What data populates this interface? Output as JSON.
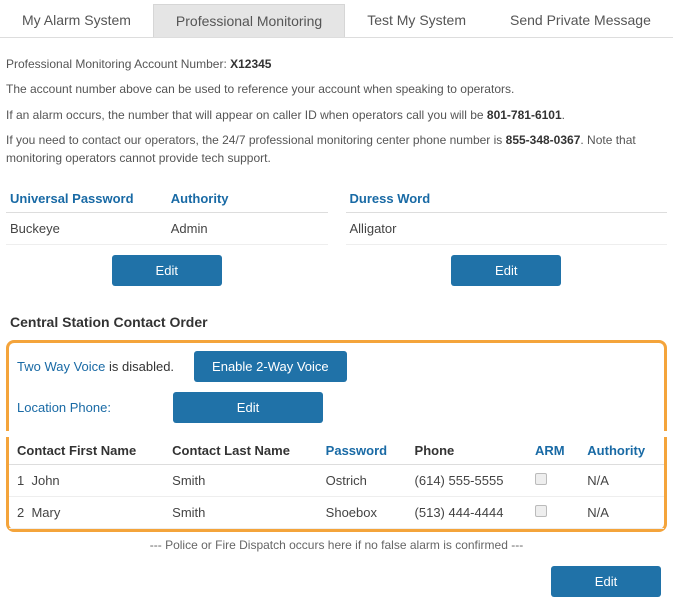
{
  "tabs": [
    {
      "label": "My Alarm System"
    },
    {
      "label": "Professional Monitoring"
    },
    {
      "label": "Test My System"
    },
    {
      "label": "Send Private Message"
    }
  ],
  "activeTab": 1,
  "account": {
    "prefix": "Professional Monitoring Account Number: ",
    "number": "X12345"
  },
  "blurbs": {
    "line1": "The account number above can be used to reference your account when speaking to operators.",
    "line2_pre": "If an alarm occurs, the number that will appear on caller ID when operators call you will be ",
    "line2_num": "801-781-6101",
    "line2_post": ".",
    "line3_pre": "If you need to contact our operators, the 24/7 professional monitoring center phone number is ",
    "line3_num": "855-348-0367",
    "line3_post": ". Note that monitoring operators cannot provide tech support."
  },
  "card1": {
    "headers": [
      "Universal Password",
      "Authority"
    ],
    "values": [
      "Buckeye",
      "Admin"
    ],
    "editLabel": "Edit"
  },
  "card2": {
    "header": "Duress Word",
    "value": "Alligator",
    "editLabel": "Edit"
  },
  "sectionTitle": "Central Station Contact Order",
  "voice": {
    "linkLabel": "Two Way Voice",
    "disabledText": " is disabled.",
    "enableBtn": "Enable 2-Way Voice"
  },
  "locationPhone": {
    "label": "Location Phone:",
    "editLabel": "Edit"
  },
  "contacts": {
    "headers": {
      "first": "Contact First Name",
      "last": "Contact Last Name",
      "password": "Password",
      "phone": "Phone",
      "arm": "ARM",
      "authority": "Authority"
    },
    "rows": [
      {
        "idx": "1",
        "first": "John",
        "last": "Smith",
        "password": "Ostrich",
        "phone": "(614) 555-5555",
        "arm": false,
        "authority": "N/A"
      },
      {
        "idx": "2",
        "first": "Mary",
        "last": "Smith",
        "password": "Shoebox",
        "phone": "(513) 444-4444",
        "arm": false,
        "authority": "N/A"
      }
    ]
  },
  "dispatchNote": "--- Police or Fire Dispatch occurs here if no false alarm is confirmed ---",
  "footerEdit": "Edit"
}
